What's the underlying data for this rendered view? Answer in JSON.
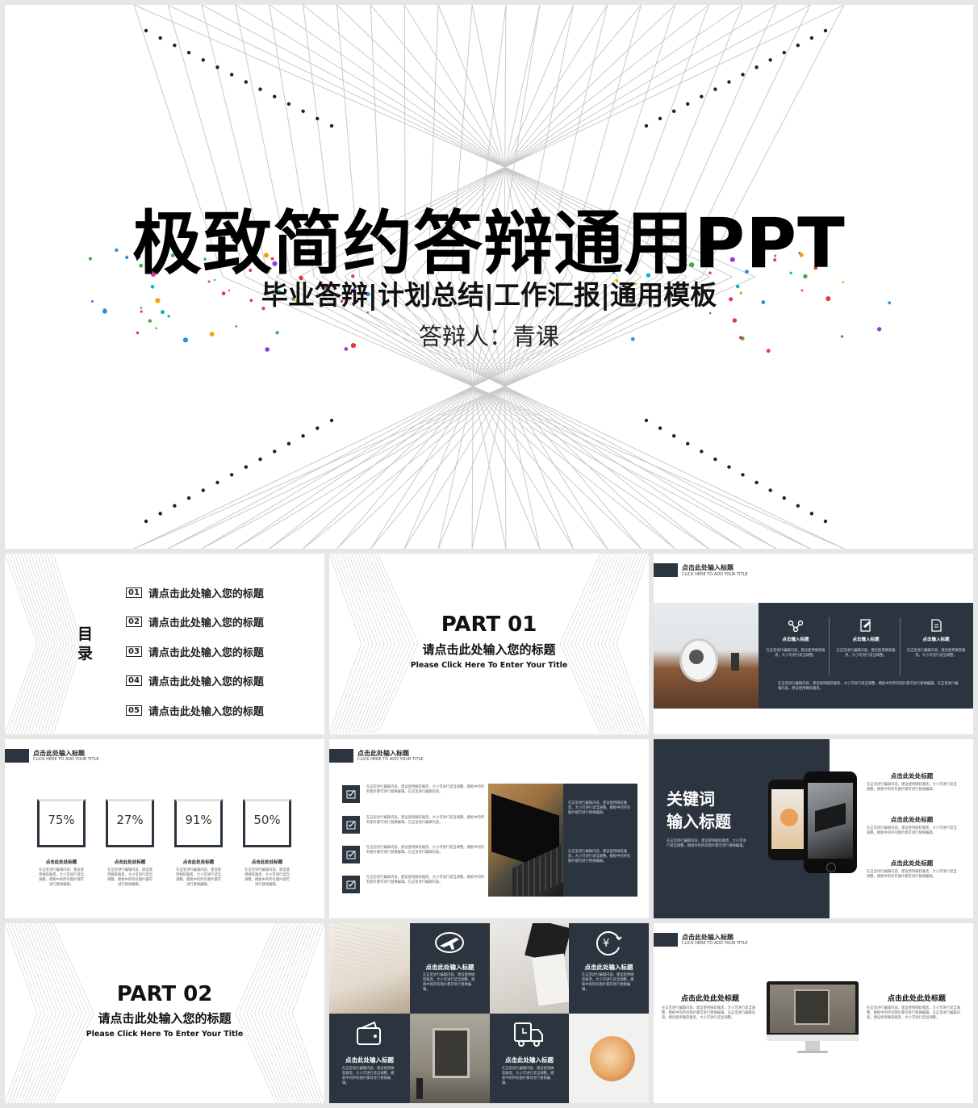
{
  "colors": {
    "dark": "#2c3440",
    "background": "#ffffff",
    "frame": "#e6e6e6"
  },
  "cover": {
    "title": "极致简约答辩通用PPT",
    "subtitle": "毕业答辩|计划总结|工作汇报|通用模板",
    "presenter": "答辩人：青课"
  },
  "toc": {
    "heading_line1": "目",
    "heading_line2": "录",
    "items": [
      {
        "num": "01",
        "label": "请点击此处输入您的标题"
      },
      {
        "num": "02",
        "label": "请点击此处输入您的标题"
      },
      {
        "num": "03",
        "label": "请点击此处输入您的标题"
      },
      {
        "num": "04",
        "label": "请点击此处输入您的标题"
      },
      {
        "num": "05",
        "label": "请点击此处输入您的标题"
      }
    ]
  },
  "part1": {
    "part": "PART 01",
    "title": "请点击此处输入您的标题",
    "en": "Please Click Here To Enter Your Title"
  },
  "part2": {
    "part": "PART 02",
    "title": "请点击此处输入您的标题",
    "en": "Please Click Here To Enter Your Title"
  },
  "header": {
    "title": "点击此处输入标题",
    "sub": "CLICK HERE TO ADD YOUR TITLE"
  },
  "features": {
    "items": [
      {
        "icon": "share-icon",
        "label": "点击输入标题"
      },
      {
        "icon": "edit-icon",
        "label": "点击输入标题"
      },
      {
        "icon": "document-icon",
        "label": "点击输入标题"
      }
    ],
    "text": "在这里进行编辑内容，建议使用微软雅黑，大小可进行适当调整。",
    "long_text": "在这里进行编辑内容，建议使用微软雅黑，大小可进行适当调整。模板中的所有图片都可进行替换编辑。在这里进行编辑内容，建议使用微软雅黑。"
  },
  "stats": {
    "items": [
      {
        "value": "75%",
        "title": "点击此处处标题"
      },
      {
        "value": "27%",
        "title": "点击此处处标题"
      },
      {
        "value": "91%",
        "title": "点击此处处标题"
      },
      {
        "value": "50%",
        "title": "点击此处处标题"
      }
    ],
    "text": "在这里进行编辑内容，建议使用微软雅黑，大小可进行适当调整。模板中的所有图片都可进行替换编辑。"
  },
  "checklist": {
    "text": "在这里进行编辑内容，建议使用微软雅黑，大小可进行适当调整。模板中的所有图片都可进行替换编辑。在这里进行编辑内容。",
    "panel_text": "在这里进行编辑内容，建议使用微软雅黑，大小可进行适当调整。模板中的所有图片都可进行替换编辑。"
  },
  "keyword": {
    "line1": "关键词",
    "line2": "输入标题",
    "text": "在这里进行编辑内容，建议使用微软雅黑，大小可进行适当调整。模板中的所有图片都可进行替换编辑。",
    "items": [
      {
        "title": "点击此处处标题"
      },
      {
        "title": "点击此处处标题"
      },
      {
        "title": "点击此处处标题"
      }
    ]
  },
  "grid": {
    "items": [
      {
        "icon": "plane-icon",
        "title": "点击此处输入标题"
      },
      {
        "icon": "yen-icon",
        "title": "点击此处输入标题"
      },
      {
        "icon": "wallet-icon",
        "title": "点击此处输入标题"
      },
      {
        "icon": "truck-icon",
        "title": "点击此处输入标题"
      }
    ],
    "text": "在这里进行编辑内容，建议使用微软雅黑，大小可进行适当调整。模板中的所有图片都可进行替换编辑。"
  },
  "monitor": {
    "left_title": "点击此处此处标题",
    "right_title": "点击此处此处标题",
    "text": "在这里进行编辑内容，建议使用微软雅黑，大小可进行适当调整。模板中的所有图片都可进行替换编辑。在这里进行编辑内容，建议使用微软雅黑，大小可进行适当调整。"
  }
}
